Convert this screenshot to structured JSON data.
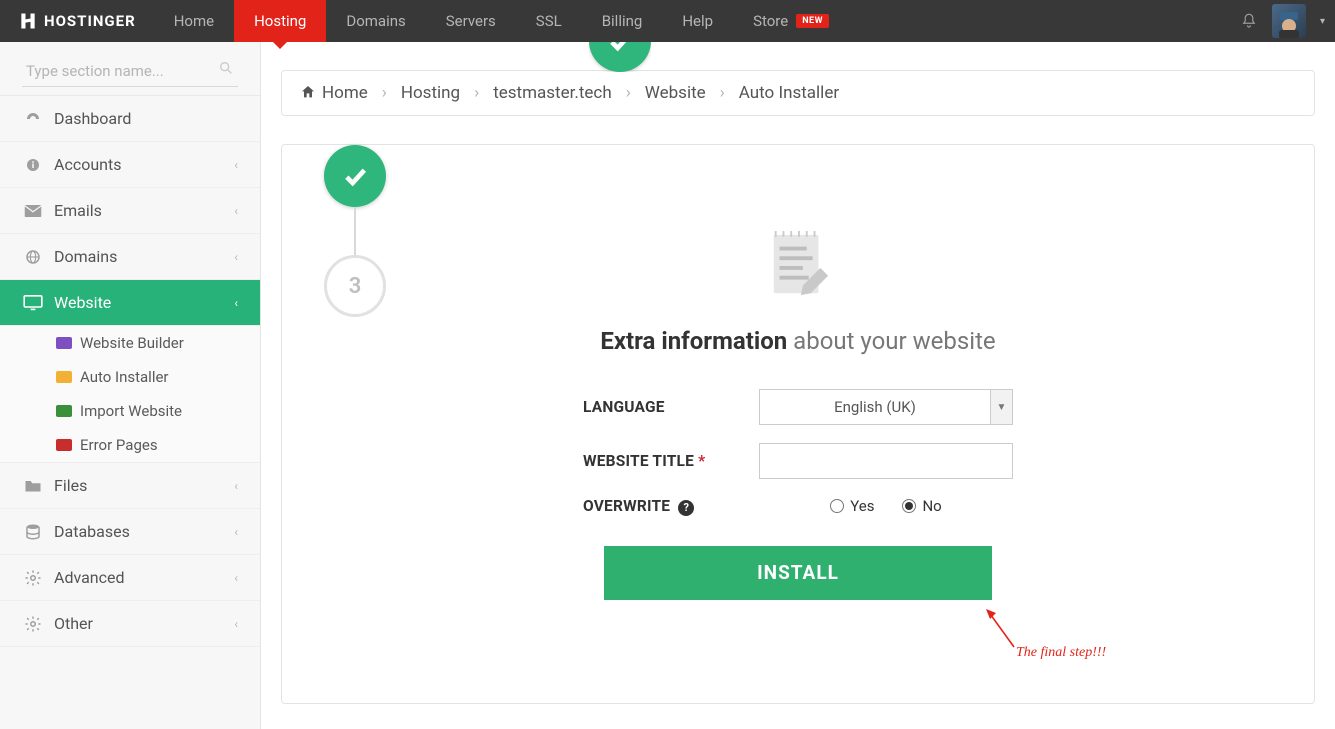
{
  "brand": "HOSTINGER",
  "nav": {
    "items": [
      "Home",
      "Hosting",
      "Domains",
      "Servers",
      "SSL",
      "Billing",
      "Help",
      "Store"
    ],
    "new_badge": "NEW",
    "active_index": 1
  },
  "sidebar": {
    "search_placeholder": "Type section name...",
    "items": [
      {
        "label": "Dashboard",
        "icon": "dashboard"
      },
      {
        "label": "Accounts",
        "icon": "info",
        "chevron": true
      },
      {
        "label": "Emails",
        "icon": "mail",
        "chevron": true
      },
      {
        "label": "Domains",
        "icon": "globe",
        "chevron": true
      },
      {
        "label": "Website",
        "icon": "monitor",
        "chevron": true,
        "active": true,
        "sub": [
          {
            "label": "Website Builder"
          },
          {
            "label": "Auto Installer"
          },
          {
            "label": "Import Website"
          },
          {
            "label": "Error Pages"
          }
        ]
      },
      {
        "label": "Files",
        "icon": "folder",
        "chevron": true
      },
      {
        "label": "Databases",
        "icon": "database",
        "chevron": true
      },
      {
        "label": "Advanced",
        "icon": "gear",
        "chevron": true
      },
      {
        "label": "Other",
        "icon": "gear",
        "chevron": true
      }
    ]
  },
  "breadcrumb": [
    "Home",
    "Hosting",
    "testmaster.tech",
    "Website",
    "Auto Installer"
  ],
  "steps": {
    "done_partial": true,
    "done": true,
    "pending_number": "3"
  },
  "panel": {
    "title_strong": "Extra information",
    "title_rest": " about your website",
    "labels": {
      "language": "LANGUAGE",
      "website_title": "WEBSITE TITLE",
      "overwrite": "OVERWRITE"
    },
    "language_value": "English (UK)",
    "website_title_value": "",
    "overwrite": {
      "yes": "Yes",
      "no": "No",
      "value": "no"
    },
    "install": "INSTALL"
  },
  "annotation": "The final step!!!"
}
